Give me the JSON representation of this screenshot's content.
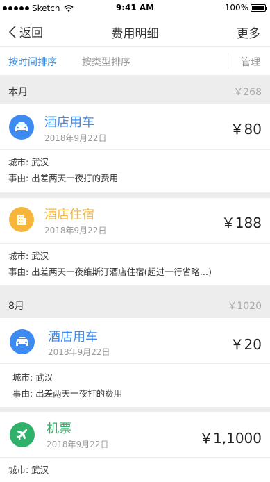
{
  "status": {
    "carrier": "Sketch",
    "time": "9:41 AM",
    "battery": "100%"
  },
  "nav": {
    "back_label": "返回",
    "title": "费用明细",
    "more_label": "更多"
  },
  "sort": {
    "by_time": "按时间排序",
    "by_type": "按类型排序",
    "manage": "管理"
  },
  "months": [
    {
      "name": "本月",
      "total": "￥268"
    },
    {
      "name": "8月",
      "total": "￥1020"
    }
  ],
  "records": [
    {
      "category": "酒店用车",
      "date": "2018年9月22日",
      "amount": "￥80",
      "city": "城市: 武汉",
      "reason": "事由: 出差两天一夜打的费用",
      "icon": "car-icon",
      "color": "#3d8af0"
    },
    {
      "category": "酒店住宿",
      "date": "2018年9月22日",
      "amount": "￥188",
      "city": "城市: 武汉",
      "reason": "事由: 出差两天一夜维斯汀酒店住宿(超过一行省略…)",
      "icon": "building-icon",
      "color": "#f6b63c"
    },
    {
      "category": "酒店用车",
      "date": "2018年9月22日",
      "amount": "￥20",
      "city": "城市: 武汉",
      "reason": "事由: 出差两天一夜打的费用",
      "icon": "car-icon",
      "color": "#3d8af0"
    },
    {
      "category": "机票",
      "date": "2018年9月22日",
      "amount": "￥1,1000",
      "city": "城市: 武汉",
      "icon": "airplane-icon",
      "color": "#2fb16a"
    }
  ]
}
